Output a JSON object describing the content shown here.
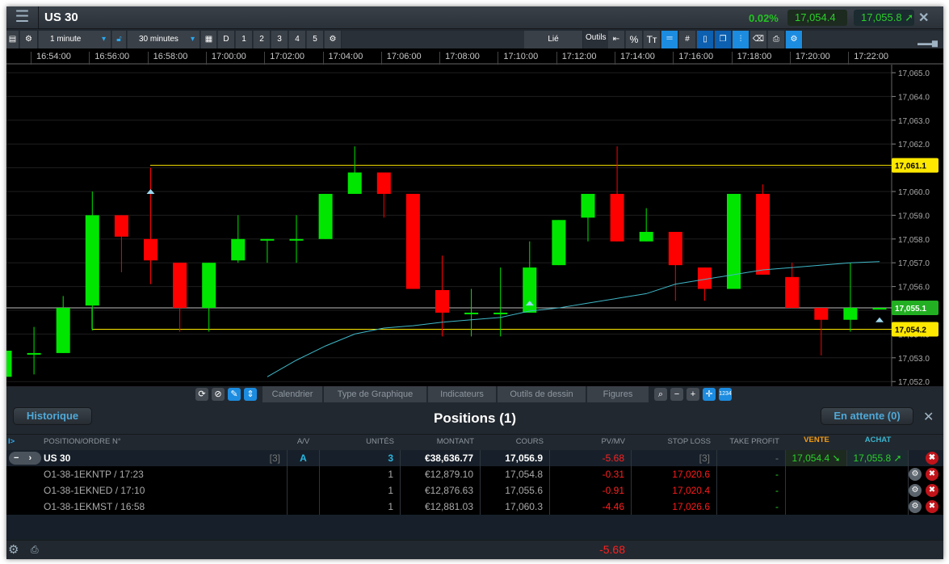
{
  "header": {
    "title": "US 30",
    "change": "0.02%",
    "sell": "17,054.4",
    "buy": "17,055.8",
    "close": "✕",
    "menu": "☰"
  },
  "toolbar": {
    "interval": "1 minute",
    "range": "30 minutes",
    "days": [
      "D",
      "1",
      "2",
      "3",
      "4",
      "5"
    ],
    "linked": "Lié",
    "tools": "Outils"
  },
  "time_labels": [
    "16:54:00",
    "16:56:00",
    "16:58:00",
    "17:00:00",
    "17:02:00",
    "17:04:00",
    "17:06:00",
    "17:08:00",
    "17:10:00",
    "17:12:00",
    "17:14:00",
    "17:16:00",
    "17:18:00",
    "17:20:00",
    "17:22:00"
  ],
  "chart_data": {
    "type": "candlestick",
    "ylim": [
      17052.0,
      17065.0
    ],
    "price_ticks": [
      "17,052.0",
      "17,053.0",
      "17,054.0",
      "17,055.0",
      "17,056.0",
      "17,057.0",
      "17,058.0",
      "17,059.0",
      "17,060.0",
      "17,061.0",
      "17,062.0",
      "17,063.0",
      "17,064.0",
      "17,065.0"
    ],
    "candles": [
      [
        17052.2,
        17053.3,
        17052.0,
        17053.3
      ],
      [
        17053.2,
        17054.3,
        17052.3,
        17053.2
      ],
      [
        17053.2,
        17055.6,
        17053.2,
        17055.1
      ],
      [
        17055.2,
        17060.0,
        17054.15,
        17059.0
      ],
      [
        17059.0,
        17059.0,
        17056.6,
        17058.1
      ],
      [
        17058.0,
        17061.0,
        17056.1,
        17057.1
      ],
      [
        17057.0,
        17057.0,
        17054.1,
        17055.1
      ],
      [
        17055.1,
        17057.0,
        17054.1,
        17057.0
      ],
      [
        17057.1,
        17059.0,
        17057.0,
        17058.0
      ],
      [
        17058.0,
        17058.0,
        17057.0,
        17058.0
      ],
      [
        17058.0,
        17059.0,
        17057.0,
        17058.0
      ],
      [
        17058.0,
        17059.9,
        17058.0,
        17059.9
      ],
      [
        17059.9,
        17061.9,
        17059.9,
        17060.8
      ],
      [
        17060.8,
        17060.8,
        17058.9,
        17059.9
      ],
      [
        17059.9,
        17059.9,
        17055.9,
        17055.9
      ],
      [
        17055.85,
        17057.3,
        17053.9,
        17054.9
      ],
      [
        17054.9,
        17055.9,
        17053.9,
        17054.9
      ],
      [
        17054.9,
        17056.8,
        17053.9,
        17054.9
      ],
      [
        17054.9,
        17057.9,
        17054.9,
        17056.8
      ],
      [
        17056.9,
        17058.8,
        17056.9,
        17058.8
      ],
      [
        17058.9,
        17059.9,
        17057.9,
        17059.9
      ],
      [
        17059.9,
        17061.9,
        17057.9,
        17057.9
      ],
      [
        17057.9,
        17059.3,
        17057.9,
        17058.3
      ],
      [
        17058.3,
        17058.3,
        17055.4,
        17056.9
      ],
      [
        17056.8,
        17056.8,
        17055.4,
        17055.9
      ],
      [
        17055.9,
        17059.9,
        17055.9,
        17059.9
      ],
      [
        17059.9,
        17060.3,
        17056.5,
        17056.5
      ],
      [
        17056.4,
        17057.0,
        17055.1,
        17055.1
      ],
      [
        17055.1,
        17055.1,
        17053.1,
        17054.6
      ],
      [
        17054.6,
        17057.0,
        17054.1,
        17055.1
      ],
      [
        17055.1,
        17055.1,
        17055.1,
        17055.1
      ]
    ],
    "moving_average": {
      "start_index": 9,
      "values": [
        17052.2,
        17052.9,
        17053.5,
        17054.0,
        17054.25,
        17054.35,
        17054.5,
        17054.6,
        17054.7,
        17054.97,
        17055.1,
        17055.3,
        17055.5,
        17055.7,
        17056.1,
        17056.3,
        17056.5,
        17056.7,
        17056.8,
        17056.9,
        17057.0,
        17057.05
      ]
    },
    "levels": [
      {
        "value": 17061.1,
        "label": "17,061.1",
        "color": "#ffe800"
      },
      {
        "value": 17055.1,
        "label": "17,055.1",
        "color": "#22b022"
      },
      {
        "value": 17054.2,
        "label": "17,054.2",
        "color": "#ffe800"
      }
    ],
    "markers": [
      {
        "index": 5,
        "value": 17060.0
      },
      {
        "index": 18,
        "value": 17055.3
      },
      {
        "index": 30,
        "value": 17054.6
      }
    ],
    "up_color": "#00e600",
    "down_color": "#ff0000",
    "ma_color": "#3fb8c8"
  },
  "chart_tabs": [
    "Calendrier",
    "Type de Graphique",
    "Indicateurs",
    "Outils de dessin",
    "Figures"
  ],
  "positions": {
    "history": "Historique",
    "title": "Positions (1)",
    "pending": "En attente (0)",
    "close": "✕",
    "columns": {
      "expand": "I>",
      "position": "POSITION/ORDRE N°",
      "av": "A/V",
      "units": "UNITÉS",
      "amount": "MONTANT",
      "price": "COURS",
      "pl": "PV/MV",
      "stop": "STOP LOSS",
      "take": "TAKE PROFIT",
      "sell": "VENTE",
      "buy": "ACHAT"
    },
    "summary": {
      "name": "US 30",
      "count": "[3]",
      "av": "A",
      "units": "3",
      "amount": "€38,636.77",
      "price": "17,056.9",
      "pl": "-5.68",
      "stop": "[3]",
      "take": "-",
      "sell": "17,054.4",
      "buy": "17,055.8"
    },
    "orders": [
      {
        "id": "O1-38-1EKNTP / 17:23",
        "units": "1",
        "amount": "€12,879.10",
        "price": "17,054.8",
        "pl": "-0.31",
        "stop": "17,020.6",
        "take": "-"
      },
      {
        "id": "O1-38-1EKNED / 17:10",
        "units": "1",
        "amount": "€12,876.63",
        "price": "17,055.6",
        "pl": "-0.91",
        "stop": "17,020.4",
        "take": "-"
      },
      {
        "id": "O1-38-1EKMST / 16:58",
        "units": "1",
        "amount": "€12,881.03",
        "price": "17,060.3",
        "pl": "-4.46",
        "stop": "17,026.6",
        "take": "-"
      }
    ],
    "total": "-5.68"
  }
}
